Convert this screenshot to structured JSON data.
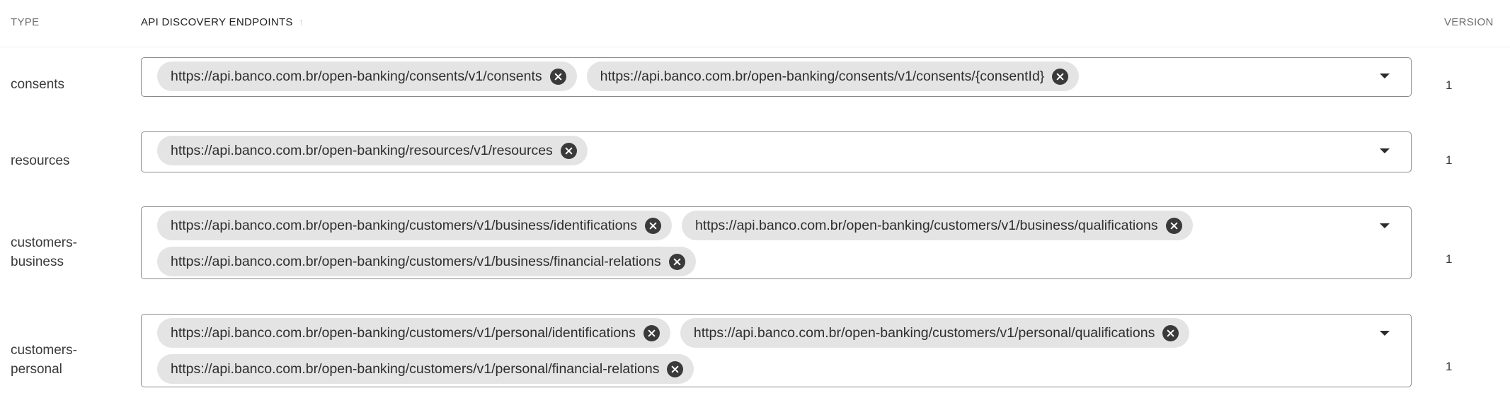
{
  "header": {
    "type": "TYPE",
    "endpoints": "API DISCOVERY ENDPOINTS",
    "sort_icon": "arrow-up-icon",
    "version": "VERSION"
  },
  "rows": [
    {
      "type": "consents",
      "endpoints": [
        "https://api.banco.com.br/open-banking/consents/v1/consents",
        "https://api.banco.com.br/open-banking/consents/v1/consents/{consentId}"
      ],
      "version": "1"
    },
    {
      "type": "resources",
      "endpoints": [
        "https://api.banco.com.br/open-banking/resources/v1/resources"
      ],
      "version": "1"
    },
    {
      "type": "customers-\nbusiness",
      "endpoints": [
        "https://api.banco.com.br/open-banking/customers/v1/business/identifications",
        "https://api.banco.com.br/open-banking/customers/v1/business/qualifications",
        "https://api.banco.com.br/open-banking/customers/v1/business/financial-relations"
      ],
      "version": "1"
    },
    {
      "type": "customers-\npersonal",
      "endpoints": [
        "https://api.banco.com.br/open-banking/customers/v1/personal/identifications",
        "https://api.banco.com.br/open-banking/customers/v1/personal/qualifications",
        "https://api.banco.com.br/open-banking/customers/v1/personal/financial-relations"
      ],
      "version": "1"
    }
  ],
  "icons": {
    "chip_remove": "close-circle-icon",
    "dropdown": "chevron-down-icon"
  },
  "colors": {
    "chip_bg": "#e4e4e4",
    "chip_remove_bg": "#3a3a3a",
    "border": "#8a8a8a"
  }
}
